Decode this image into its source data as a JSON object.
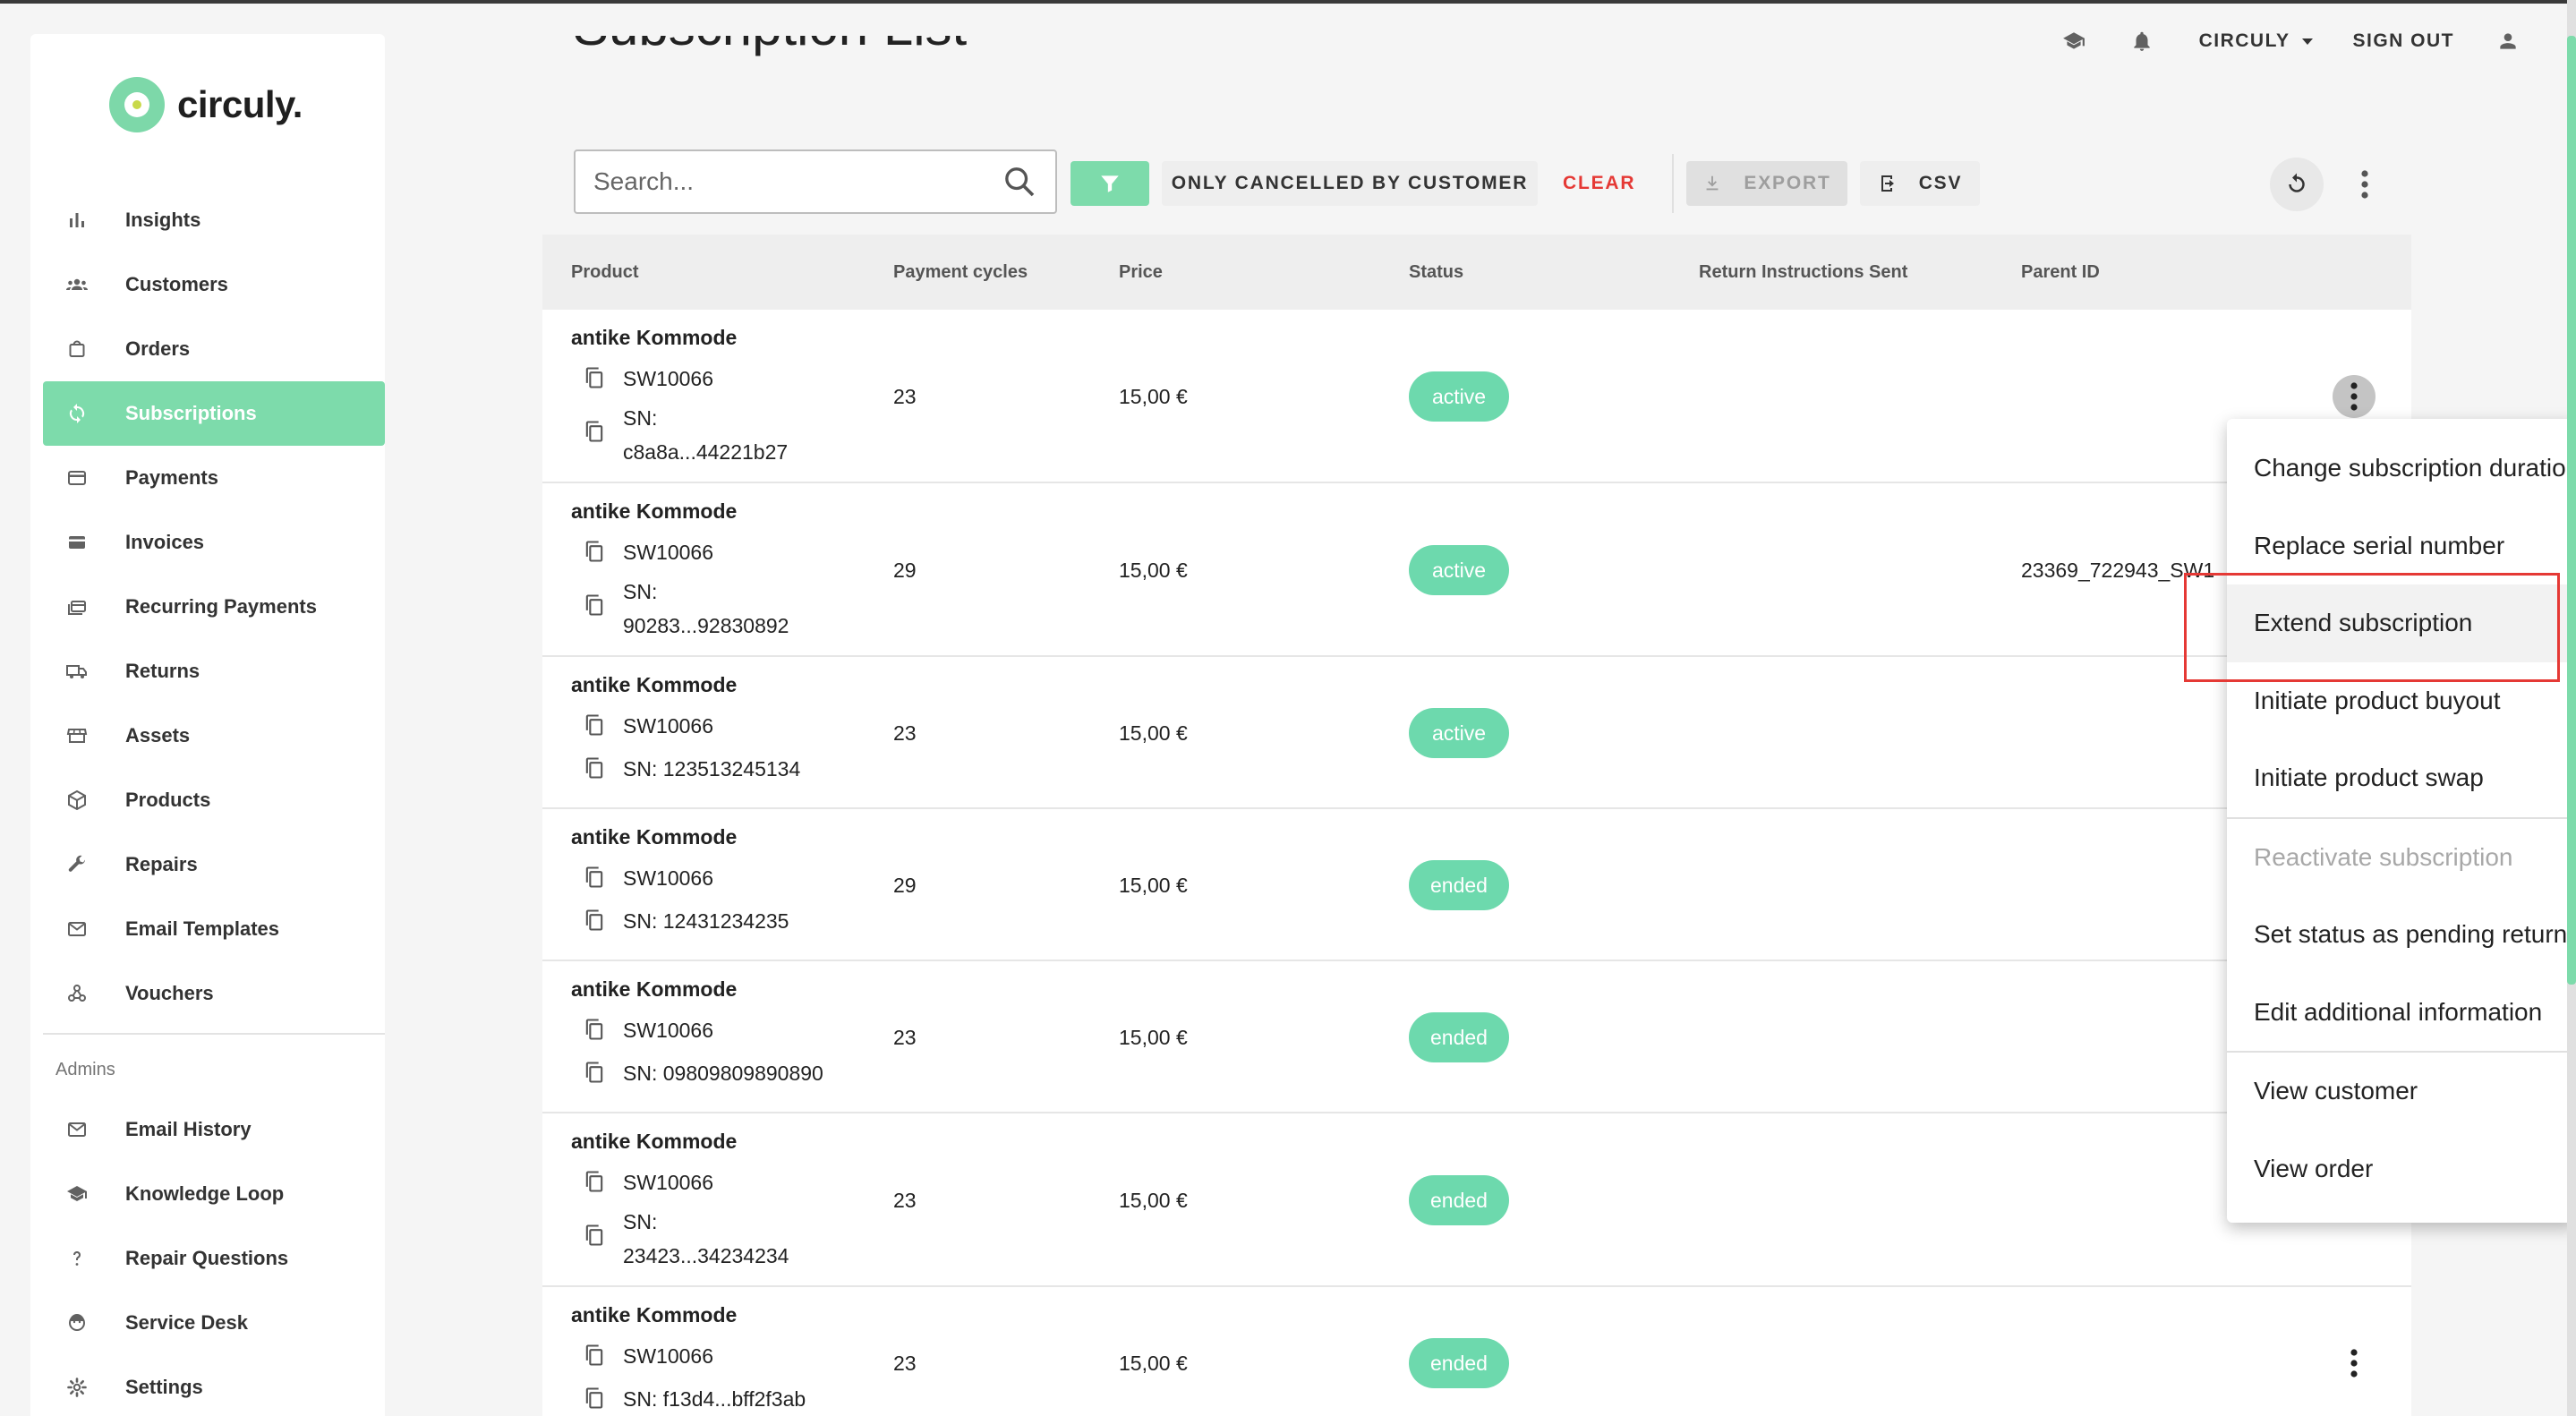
{
  "brand": {
    "name": "circuly."
  },
  "topbar": {
    "company_label": "CIRCULY",
    "signout_label": "SIGN OUT"
  },
  "page": {
    "title": "Subscription List"
  },
  "sidebar": {
    "items": [
      {
        "label": "Insights",
        "icon": "bar-chart-icon"
      },
      {
        "label": "Customers",
        "icon": "customers-icon"
      },
      {
        "label": "Orders",
        "icon": "shopping-bag-icon"
      },
      {
        "label": "Subscriptions",
        "icon": "sync-icon",
        "active": true
      },
      {
        "label": "Payments",
        "icon": "credit-card-icon"
      },
      {
        "label": "Invoices",
        "icon": "invoice-card-icon"
      },
      {
        "label": "Recurring Payments",
        "icon": "recurring-payments-icon"
      },
      {
        "label": "Returns",
        "icon": "truck-icon"
      },
      {
        "label": "Assets",
        "icon": "store-icon"
      },
      {
        "label": "Products",
        "icon": "cube-icon"
      },
      {
        "label": "Repairs",
        "icon": "wrench-icon"
      },
      {
        "label": "Email Templates",
        "icon": "mail-icon"
      },
      {
        "label": "Vouchers",
        "icon": "hub-icon"
      }
    ],
    "admins_label": "Admins",
    "admin_items": [
      {
        "label": "Email History",
        "icon": "mail-icon"
      },
      {
        "label": "Knowledge Loop",
        "icon": "school-icon"
      },
      {
        "label": "Repair Questions",
        "icon": "question-icon"
      },
      {
        "label": "Service Desk",
        "icon": "support-icon"
      },
      {
        "label": "Settings",
        "icon": "gear-icon"
      }
    ]
  },
  "toolbar": {
    "search_placeholder": "Search...",
    "cancelled_label": "ONLY CANCELLED BY CUSTOMER",
    "clear_label": "CLEAR",
    "export_label": "EXPORT",
    "csv_label": "CSV"
  },
  "table": {
    "headers": [
      "Product",
      "Payment cycles",
      "Price",
      "Status",
      "Return Instructions Sent",
      "Parent ID"
    ],
    "rows": [
      {
        "product": "antike Kommode",
        "sku": "SW10066",
        "sn_label": "SN:",
        "sn": "c8a8a...44221b27",
        "sn_wrap": true,
        "cycles": "23",
        "price": "15,00 €",
        "status": "active",
        "parent_id": ""
      },
      {
        "product": "antike Kommode",
        "sku": "SW10066",
        "sn_label": "SN:",
        "sn": "90283...92830892",
        "sn_wrap": true,
        "cycles": "29",
        "price": "15,00 €",
        "status": "active",
        "parent_id": "23369_722943_SW1"
      },
      {
        "product": "antike Kommode",
        "sku": "SW10066",
        "sn_label": "SN:",
        "sn": "123513245134",
        "sn_wrap": false,
        "cycles": "23",
        "price": "15,00 €",
        "status": "active",
        "parent_id": ""
      },
      {
        "product": "antike Kommode",
        "sku": "SW10066",
        "sn_label": "SN:",
        "sn": "12431234235",
        "sn_wrap": false,
        "cycles": "29",
        "price": "15,00 €",
        "status": "ended",
        "parent_id": ""
      },
      {
        "product": "antike Kommode",
        "sku": "SW10066",
        "sn_label": "SN:",
        "sn": "09809809890890",
        "sn_wrap": false,
        "cycles": "23",
        "price": "15,00 €",
        "status": "ended",
        "parent_id": ""
      },
      {
        "product": "antike Kommode",
        "sku": "SW10066",
        "sn_label": "SN:",
        "sn": "23423...34234234",
        "sn_wrap": true,
        "cycles": "23",
        "price": "15,00 €",
        "status": "ended",
        "parent_id": ""
      },
      {
        "product": "antike Kommode",
        "sku": "SW10066",
        "sn_label": "SN:",
        "sn": "f13d4...bff2f3ab",
        "sn_wrap": false,
        "cycles": "23",
        "price": "15,00 €",
        "status": "ended",
        "parent_id": ""
      }
    ]
  },
  "context_menu": {
    "items": [
      {
        "label": "Change subscription duration"
      },
      {
        "label": "Replace serial number"
      },
      {
        "label": "Extend subscription",
        "highlighted": true
      },
      {
        "label": "Initiate product buyout"
      },
      {
        "label": "Initiate product swap"
      },
      {
        "label": "Reactivate subscription",
        "disabled": true
      },
      {
        "label": "Set status as pending return"
      },
      {
        "label": "Edit additional information"
      },
      {
        "label": "View customer"
      },
      {
        "label": "View order"
      }
    ]
  },
  "colors": {
    "accent": "#7ddbab",
    "badge": "#6dd9ad",
    "danger": "#e53935"
  }
}
